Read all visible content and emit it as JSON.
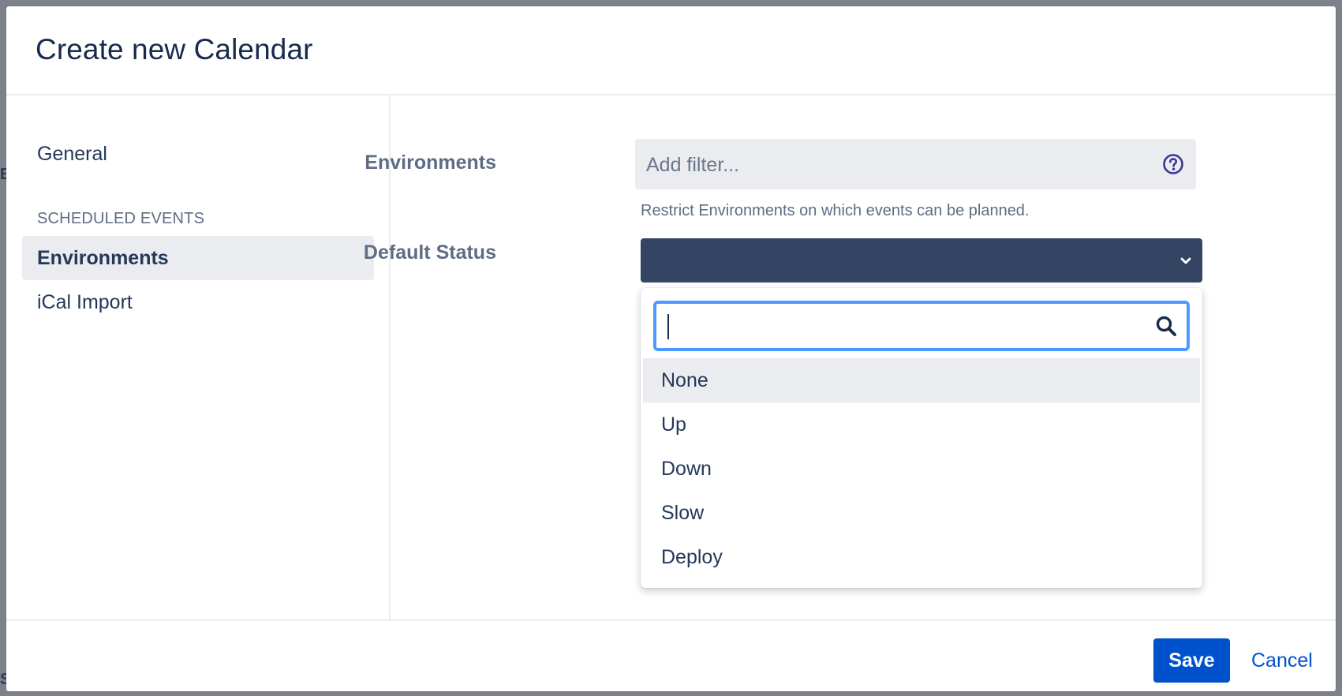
{
  "dialog": {
    "title": "Create new Calendar"
  },
  "sidebar": {
    "items": [
      {
        "label": "General"
      },
      {
        "label": "Environments"
      },
      {
        "label": "iCal Import"
      }
    ],
    "section_heading": "SCHEDULED EVENTS",
    "active_item": "Environments"
  },
  "form": {
    "environments": {
      "label": "Environments",
      "placeholder": "Add filter...",
      "help_text": "Restrict Environments on which events can be planned.",
      "help_icon": "question-circle-icon"
    },
    "default_status": {
      "label": "Default Status",
      "selected_value": "",
      "chevron_icon": "chevron-down-icon",
      "dropdown": {
        "search_value": "",
        "search_icon": "search-icon",
        "highlighted": "None",
        "options": [
          {
            "label": "None"
          },
          {
            "label": "Up"
          },
          {
            "label": "Down"
          },
          {
            "label": "Slow"
          },
          {
            "label": "Deploy"
          }
        ]
      }
    }
  },
  "footer": {
    "save_label": "Save",
    "cancel_label": "Cancel"
  },
  "colors": {
    "primary": "#0052cc",
    "select_bg": "#344563",
    "focus_ring": "#4c9aff",
    "text_dark": "#172b4d",
    "text_muted": "#5e6c84",
    "highlight_bg": "#ebecf0"
  }
}
